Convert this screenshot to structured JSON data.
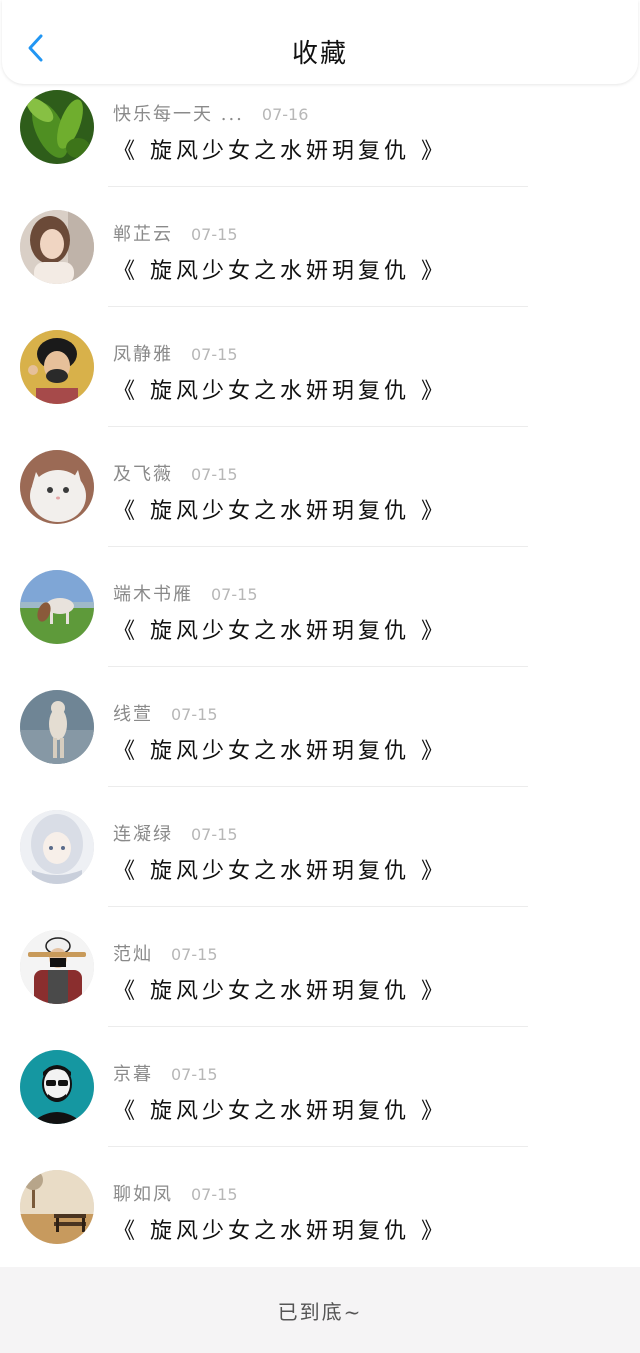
{
  "header": {
    "title": "收藏",
    "back_icon": "chevron-left-icon",
    "accent_color": "#2196f3"
  },
  "items": [
    {
      "name": "快乐每一天 ...",
      "date": "07-16",
      "work": "《 旋风少女之水妍玥复仇 》",
      "avatar": "leaves-avatar"
    },
    {
      "name": "郸芷云",
      "date": "07-15",
      "work": "《 旋风少女之水妍玥复仇 》",
      "avatar": "girl-avatar"
    },
    {
      "name": "凤静雅",
      "date": "07-15",
      "work": "《 旋风少女之水妍玥复仇 》",
      "avatar": "bearded-man-avatar"
    },
    {
      "name": "及飞薇",
      "date": "07-15",
      "work": "《 旋风少女之水妍玥复仇 》",
      "avatar": "white-cat-avatar"
    },
    {
      "name": "端木书雁",
      "date": "07-15",
      "work": "《 旋风少女之水妍玥复仇 》",
      "avatar": "horse-avatar"
    },
    {
      "name": "线萱",
      "date": "07-15",
      "work": "《 旋风少女之水妍玥复仇 》",
      "avatar": "dog-avatar"
    },
    {
      "name": "连凝绿",
      "date": "07-15",
      "work": "《 旋风少女之水妍玥复仇 》",
      "avatar": "anime-girl-avatar"
    },
    {
      "name": "范灿",
      "date": "07-15",
      "work": "《 旋风少女之水妍玥复仇 》",
      "avatar": "masked-man-avatar"
    },
    {
      "name": "京暮",
      "date": "07-15",
      "work": "《 旋风少女之水妍玥复仇 》",
      "avatar": "sunglasses-man-avatar"
    },
    {
      "name": "聊如凤",
      "date": "07-15",
      "work": "《 旋风少女之水妍玥复仇 》",
      "avatar": "bench-avatar"
    }
  ],
  "footer": {
    "text": "已到底~"
  }
}
